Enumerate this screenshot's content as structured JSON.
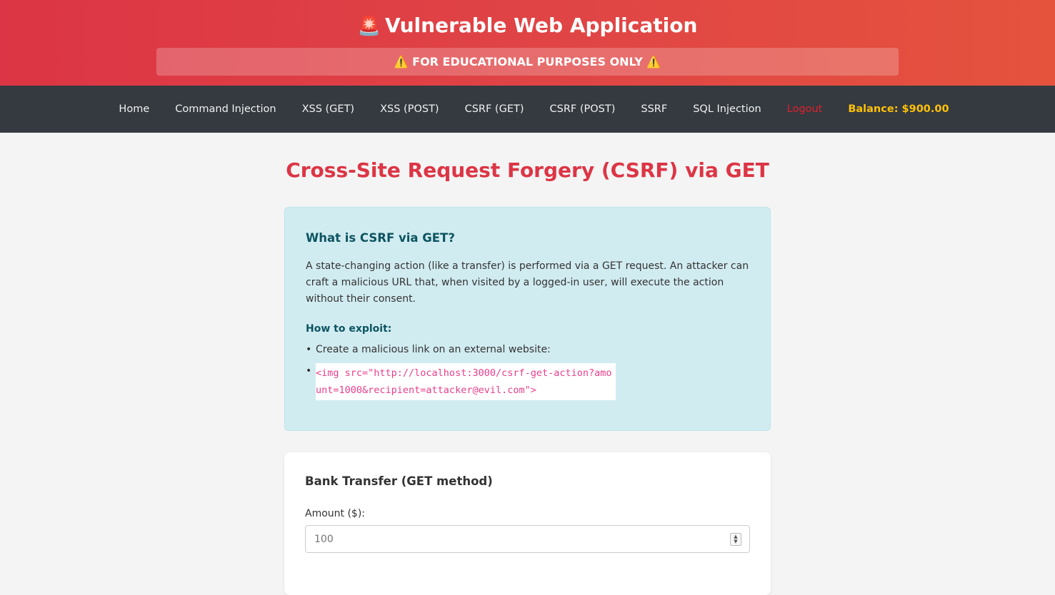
{
  "header": {
    "emoji": "🚨",
    "title": "Vulnerable Web Application",
    "warning": "⚠️ FOR EDUCATIONAL PURPOSES ONLY ⚠️"
  },
  "nav": {
    "items": [
      "Home",
      "Command Injection",
      "XSS (GET)",
      "XSS (POST)",
      "CSRF (GET)",
      "CSRF (POST)",
      "SSRF",
      "SQL Injection"
    ],
    "logout": "Logout",
    "balance": "Balance: $900.00"
  },
  "page": {
    "title": "Cross-Site Request Forgery (CSRF) via GET"
  },
  "info": {
    "heading": "What is CSRF via GET?",
    "description": "A state-changing action (like a transfer) is performed via a GET request. An attacker can craft a malicious URL that, when visited by a logged-in user, will execute the action without their consent.",
    "exploit_heading": "How to exploit:",
    "steps": [
      "Create a malicious link on an external website:"
    ],
    "code": "<img src=\"http://localhost:3000/csrf-get-action?amount=1000&recipient=attacker@evil.com\">"
  },
  "form": {
    "title": "Bank Transfer (GET method)",
    "amount_label": "Amount ($):",
    "amount_placeholder": "100"
  },
  "colors": {
    "accent": "#dc3545",
    "nav_bg": "#343a40",
    "balance": "#ffc107",
    "info_bg": "#d1ecf1"
  }
}
